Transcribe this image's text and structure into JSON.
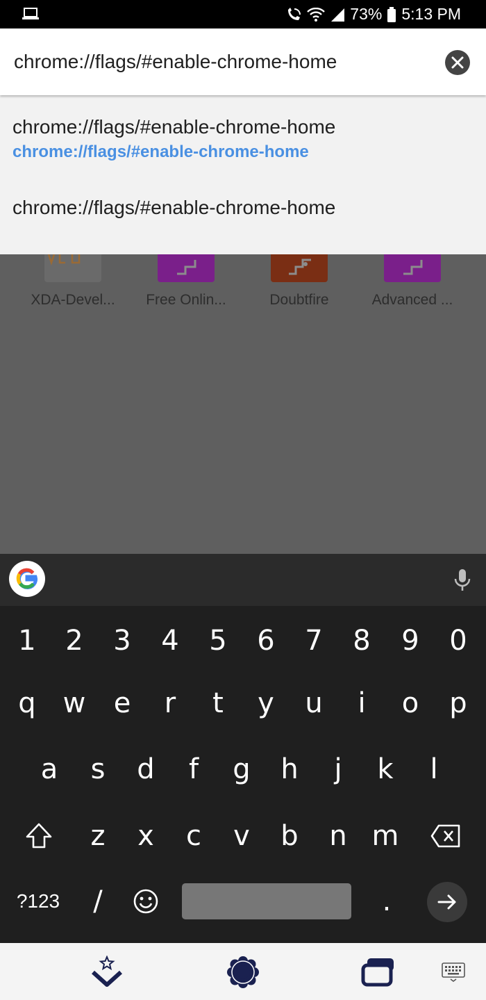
{
  "status_bar": {
    "battery_percent": "73%",
    "time": "5:13 PM",
    "icons": [
      "laptop-icon",
      "wifi-calling-icon",
      "wifi-icon",
      "signal-icon",
      "battery-icon"
    ]
  },
  "url_bar": {
    "value": "chrome://flags/#enable-chrome-home",
    "clear_icon": "close-icon"
  },
  "suggestions": [
    {
      "title": "chrome://flags/#enable-chrome-home",
      "url": "chrome://flags/#enable-chrome-home"
    },
    {
      "title": "chrome://flags/#enable-chrome-home"
    }
  ],
  "tiles": [
    {
      "label": "XDA-Devel...",
      "color": "#6a6a6a"
    },
    {
      "label": "Free Onlin...",
      "color": "#7a1f8a"
    },
    {
      "label": "Doubtfire",
      "color": "#7a2e14"
    },
    {
      "label": "Advanced ...",
      "color": "#7a1f8a"
    }
  ],
  "keyboard": {
    "rows": [
      [
        "1",
        "2",
        "3",
        "4",
        "5",
        "6",
        "7",
        "8",
        "9",
        "0"
      ],
      [
        "q",
        "w",
        "e",
        "r",
        "t",
        "y",
        "u",
        "i",
        "o",
        "p"
      ],
      [
        "a",
        "s",
        "d",
        "f",
        "g",
        "h",
        "j",
        "k",
        "l"
      ],
      [
        "z",
        "x",
        "c",
        "v",
        "b",
        "n",
        "m"
      ]
    ],
    "symbols_label": "?123",
    "slash_label": "/",
    "period_label": ".",
    "colors": {
      "keyboard_bg": "#1f1f1f",
      "suggestion_strip": "#2b2b2b",
      "spacebar": "#777777"
    }
  },
  "bottom_nav": {
    "icons": [
      "back-star-icon",
      "home-flower-icon",
      "recents-icon",
      "keyboard-switch-icon"
    ],
    "color": "#1a2150"
  },
  "colors": {
    "link_blue": "#4a90e2",
    "overlay": "#5f5f5f"
  }
}
